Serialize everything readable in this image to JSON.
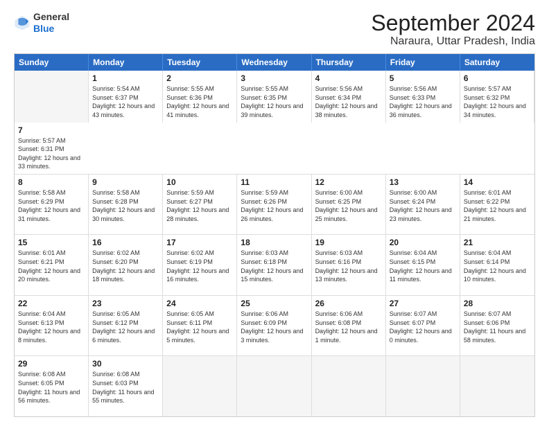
{
  "logo": {
    "general": "General",
    "blue": "Blue"
  },
  "title": "September 2024",
  "subtitle": "Naraura, Uttar Pradesh, India",
  "days": [
    "Sunday",
    "Monday",
    "Tuesday",
    "Wednesday",
    "Thursday",
    "Friday",
    "Saturday"
  ],
  "rows": [
    [
      {
        "day": "",
        "empty": true
      },
      {
        "day": "1",
        "sunrise": "Sunrise: 5:54 AM",
        "sunset": "Sunset: 6:37 PM",
        "daylight": "Daylight: 12 hours and 43 minutes."
      },
      {
        "day": "2",
        "sunrise": "Sunrise: 5:55 AM",
        "sunset": "Sunset: 6:36 PM",
        "daylight": "Daylight: 12 hours and 41 minutes."
      },
      {
        "day": "3",
        "sunrise": "Sunrise: 5:55 AM",
        "sunset": "Sunset: 6:35 PM",
        "daylight": "Daylight: 12 hours and 39 minutes."
      },
      {
        "day": "4",
        "sunrise": "Sunrise: 5:56 AM",
        "sunset": "Sunset: 6:34 PM",
        "daylight": "Daylight: 12 hours and 38 minutes."
      },
      {
        "day": "5",
        "sunrise": "Sunrise: 5:56 AM",
        "sunset": "Sunset: 6:33 PM",
        "daylight": "Daylight: 12 hours and 36 minutes."
      },
      {
        "day": "6",
        "sunrise": "Sunrise: 5:57 AM",
        "sunset": "Sunset: 6:32 PM",
        "daylight": "Daylight: 12 hours and 34 minutes."
      },
      {
        "day": "7",
        "sunrise": "Sunrise: 5:57 AM",
        "sunset": "Sunset: 6:31 PM",
        "daylight": "Daylight: 12 hours and 33 minutes."
      }
    ],
    [
      {
        "day": "8",
        "sunrise": "Sunrise: 5:58 AM",
        "sunset": "Sunset: 6:29 PM",
        "daylight": "Daylight: 12 hours and 31 minutes."
      },
      {
        "day": "9",
        "sunrise": "Sunrise: 5:58 AM",
        "sunset": "Sunset: 6:28 PM",
        "daylight": "Daylight: 12 hours and 30 minutes."
      },
      {
        "day": "10",
        "sunrise": "Sunrise: 5:59 AM",
        "sunset": "Sunset: 6:27 PM",
        "daylight": "Daylight: 12 hours and 28 minutes."
      },
      {
        "day": "11",
        "sunrise": "Sunrise: 5:59 AM",
        "sunset": "Sunset: 6:26 PM",
        "daylight": "Daylight: 12 hours and 26 minutes."
      },
      {
        "day": "12",
        "sunrise": "Sunrise: 6:00 AM",
        "sunset": "Sunset: 6:25 PM",
        "daylight": "Daylight: 12 hours and 25 minutes."
      },
      {
        "day": "13",
        "sunrise": "Sunrise: 6:00 AM",
        "sunset": "Sunset: 6:24 PM",
        "daylight": "Daylight: 12 hours and 23 minutes."
      },
      {
        "day": "14",
        "sunrise": "Sunrise: 6:01 AM",
        "sunset": "Sunset: 6:22 PM",
        "daylight": "Daylight: 12 hours and 21 minutes."
      }
    ],
    [
      {
        "day": "15",
        "sunrise": "Sunrise: 6:01 AM",
        "sunset": "Sunset: 6:21 PM",
        "daylight": "Daylight: 12 hours and 20 minutes."
      },
      {
        "day": "16",
        "sunrise": "Sunrise: 6:02 AM",
        "sunset": "Sunset: 6:20 PM",
        "daylight": "Daylight: 12 hours and 18 minutes."
      },
      {
        "day": "17",
        "sunrise": "Sunrise: 6:02 AM",
        "sunset": "Sunset: 6:19 PM",
        "daylight": "Daylight: 12 hours and 16 minutes."
      },
      {
        "day": "18",
        "sunrise": "Sunrise: 6:03 AM",
        "sunset": "Sunset: 6:18 PM",
        "daylight": "Daylight: 12 hours and 15 minutes."
      },
      {
        "day": "19",
        "sunrise": "Sunrise: 6:03 AM",
        "sunset": "Sunset: 6:16 PM",
        "daylight": "Daylight: 12 hours and 13 minutes."
      },
      {
        "day": "20",
        "sunrise": "Sunrise: 6:04 AM",
        "sunset": "Sunset: 6:15 PM",
        "daylight": "Daylight: 12 hours and 11 minutes."
      },
      {
        "day": "21",
        "sunrise": "Sunrise: 6:04 AM",
        "sunset": "Sunset: 6:14 PM",
        "daylight": "Daylight: 12 hours and 10 minutes."
      }
    ],
    [
      {
        "day": "22",
        "sunrise": "Sunrise: 6:04 AM",
        "sunset": "Sunset: 6:13 PM",
        "daylight": "Daylight: 12 hours and 8 minutes."
      },
      {
        "day": "23",
        "sunrise": "Sunrise: 6:05 AM",
        "sunset": "Sunset: 6:12 PM",
        "daylight": "Daylight: 12 hours and 6 minutes."
      },
      {
        "day": "24",
        "sunrise": "Sunrise: 6:05 AM",
        "sunset": "Sunset: 6:11 PM",
        "daylight": "Daylight: 12 hours and 5 minutes."
      },
      {
        "day": "25",
        "sunrise": "Sunrise: 6:06 AM",
        "sunset": "Sunset: 6:09 PM",
        "daylight": "Daylight: 12 hours and 3 minutes."
      },
      {
        "day": "26",
        "sunrise": "Sunrise: 6:06 AM",
        "sunset": "Sunset: 6:08 PM",
        "daylight": "Daylight: 12 hours and 1 minute."
      },
      {
        "day": "27",
        "sunrise": "Sunrise: 6:07 AM",
        "sunset": "Sunset: 6:07 PM",
        "daylight": "Daylight: 12 hours and 0 minutes."
      },
      {
        "day": "28",
        "sunrise": "Sunrise: 6:07 AM",
        "sunset": "Sunset: 6:06 PM",
        "daylight": "Daylight: 11 hours and 58 minutes."
      }
    ],
    [
      {
        "day": "29",
        "sunrise": "Sunrise: 6:08 AM",
        "sunset": "Sunset: 6:05 PM",
        "daylight": "Daylight: 11 hours and 56 minutes."
      },
      {
        "day": "30",
        "sunrise": "Sunrise: 6:08 AM",
        "sunset": "Sunset: 6:03 PM",
        "daylight": "Daylight: 11 hours and 55 minutes."
      },
      {
        "day": "",
        "empty": true
      },
      {
        "day": "",
        "empty": true
      },
      {
        "day": "",
        "empty": true
      },
      {
        "day": "",
        "empty": true
      },
      {
        "day": "",
        "empty": true
      }
    ]
  ]
}
